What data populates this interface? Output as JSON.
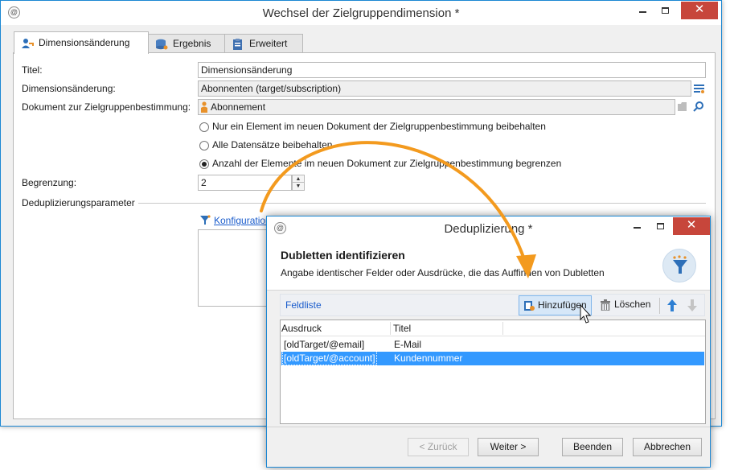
{
  "main_window": {
    "title": "Wechsel der Zielgruppendimension *",
    "tabs": [
      {
        "label": "Dimensionsänderung",
        "icon": "dimension-change-icon",
        "active": true
      },
      {
        "label": "Ergebnis",
        "icon": "database-icon",
        "active": false
      },
      {
        "label": "Erweitert",
        "icon": "clipboard-icon",
        "active": false
      }
    ],
    "form": {
      "title_label": "Titel:",
      "title_value": "Dimensionsänderung",
      "dimension_label": "Dimensionsänderung:",
      "dimension_value": "Abonnenten (target/subscription)",
      "document_label": "Dokument zur Zielgruppenbestimmung:",
      "document_value": "Abonnement",
      "radio_options": [
        {
          "label": "Nur ein Element im neuen Dokument der Zielgruppenbestimmung beibehalten",
          "checked": false
        },
        {
          "label": "Alle Datensätze beibehalten",
          "checked": false
        },
        {
          "label": "Anzahl der Elemente im neuen Dokument zur Zielgruppenbestimmung begrenzen",
          "checked": true
        }
      ],
      "limit_label": "Begrenzung:",
      "limit_value": "2",
      "dedup_section_label": "Deduplizierungsparameter",
      "config_link": "Konfiguration"
    }
  },
  "dialog": {
    "title": "Deduplizierung *",
    "heading": "Dubletten identifizieren",
    "subheading": "Angabe identischer Felder oder Ausdrücke, die das Auffinden von Dubletten",
    "toolbar": {
      "list_label": "Feldliste",
      "add_label": "Hinzufügen",
      "delete_label": "Löschen"
    },
    "table": {
      "columns": [
        "Ausdruck",
        "Titel"
      ],
      "rows": [
        {
          "expression": "[oldTarget/@email]",
          "title": "E-Mail",
          "selected": false
        },
        {
          "expression": "[oldTarget/@account]",
          "title": "Kundennummer",
          "selected": true
        }
      ]
    },
    "buttons": {
      "back": "< Zurück",
      "next": "Weiter >",
      "finish": "Beenden",
      "cancel": "Abbrechen"
    }
  },
  "colors": {
    "accent_blue": "#1b87d3",
    "selection": "#3399ff",
    "close_red": "#c7463b",
    "callout_arrow": "#f39a1e"
  }
}
